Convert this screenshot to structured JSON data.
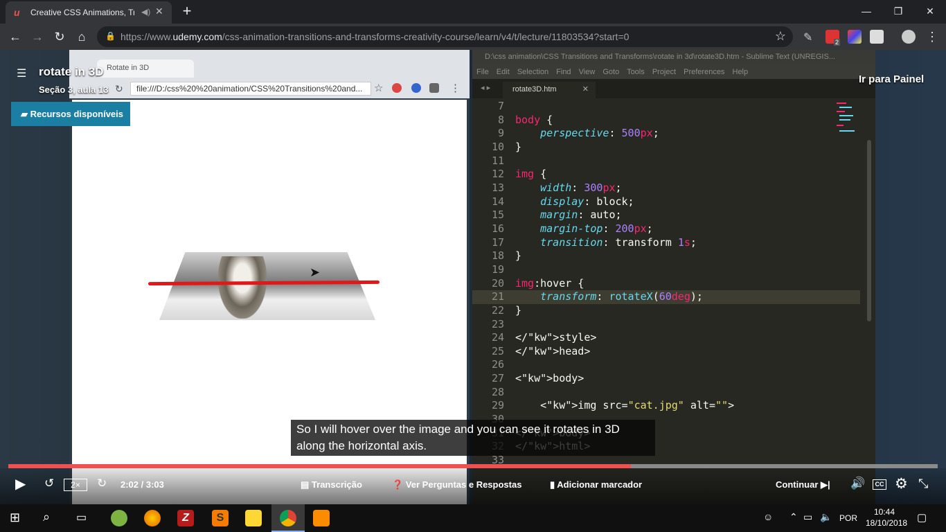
{
  "browser": {
    "tab_title": "Creative CSS Animations, Tra",
    "url_prefix": "https://www.",
    "url_domain": "udemy.com",
    "url_path": "/css-animation-transitions-and-transforms-creativity-course/learn/v4/t/lecture/11803534?start=0",
    "extension_badge": "2"
  },
  "inner_browser": {
    "tab_title": "Rotate in 3D",
    "url": "file:///D:/css%20%20animation/CSS%20Transitions%20and..."
  },
  "sublime": {
    "title": "D:\\css  animation\\CSS Transitions and Transforms\\rotate in 3d\\rotate3D.htm - Sublime Text (UNREGIS...",
    "menu": [
      "File",
      "Edit",
      "Selection",
      "Find",
      "View",
      "Goto",
      "Tools",
      "Project",
      "Preferences",
      "Help"
    ],
    "tab_name": "rotate3D.htm",
    "lines": [
      {
        "n": "7",
        "t": ""
      },
      {
        "n": "8",
        "t": "body {"
      },
      {
        "n": "9",
        "t": "    perspective: 500px;"
      },
      {
        "n": "10",
        "t": "}"
      },
      {
        "n": "11",
        "t": ""
      },
      {
        "n": "12",
        "t": "img {"
      },
      {
        "n": "13",
        "t": "    width: 300px;"
      },
      {
        "n": "14",
        "t": "    display: block;"
      },
      {
        "n": "15",
        "t": "    margin: auto;"
      },
      {
        "n": "16",
        "t": "    margin-top: 200px;"
      },
      {
        "n": "17",
        "t": "    transition: transform 1s;"
      },
      {
        "n": "18",
        "t": "}"
      },
      {
        "n": "19",
        "t": ""
      },
      {
        "n": "20",
        "t": "img:hover {"
      },
      {
        "n": "21",
        "t": "    transform: rotateX(60deg);"
      },
      {
        "n": "22",
        "t": "}"
      },
      {
        "n": "23",
        "t": ""
      },
      {
        "n": "24",
        "t": "</style>"
      },
      {
        "n": "25",
        "t": "</head>"
      },
      {
        "n": "26",
        "t": ""
      },
      {
        "n": "27",
        "t": "<body>"
      },
      {
        "n": "28",
        "t": ""
      },
      {
        "n": "29",
        "t": "    <img src=\"cat.jpg\" alt=\"\">"
      },
      {
        "n": "30",
        "t": ""
      },
      {
        "n": "31",
        "t": "</body>"
      },
      {
        "n": "32",
        "t": "</html>"
      },
      {
        "n": "33",
        "t": ""
      }
    ]
  },
  "lecture": {
    "title": "rotate in 3D",
    "subtitle": "Seção 3, aula 13",
    "resources_label": "Recursos disponíveis",
    "goto_dashboard": "Ir para Painel"
  },
  "caption": "So I will hover over the image and you can see it rotates in 3D along the horizontal axis.",
  "player": {
    "progress": 0.67,
    "speed": "2×",
    "time": "2:02 / 3:03",
    "transcript": "Transcrição",
    "questions": "Ver Perguntas e Respostas",
    "bookmark": "Adicionar marcador",
    "continue": "Continuar",
    "cc": "CC"
  },
  "taskbar": {
    "language": "POR",
    "time": "10:44",
    "date": "18/10/2018"
  },
  "colors": {
    "udemy_red": "#ec5252",
    "resources_blue": "#1a7fa3",
    "sublime_bg": "#272822"
  }
}
